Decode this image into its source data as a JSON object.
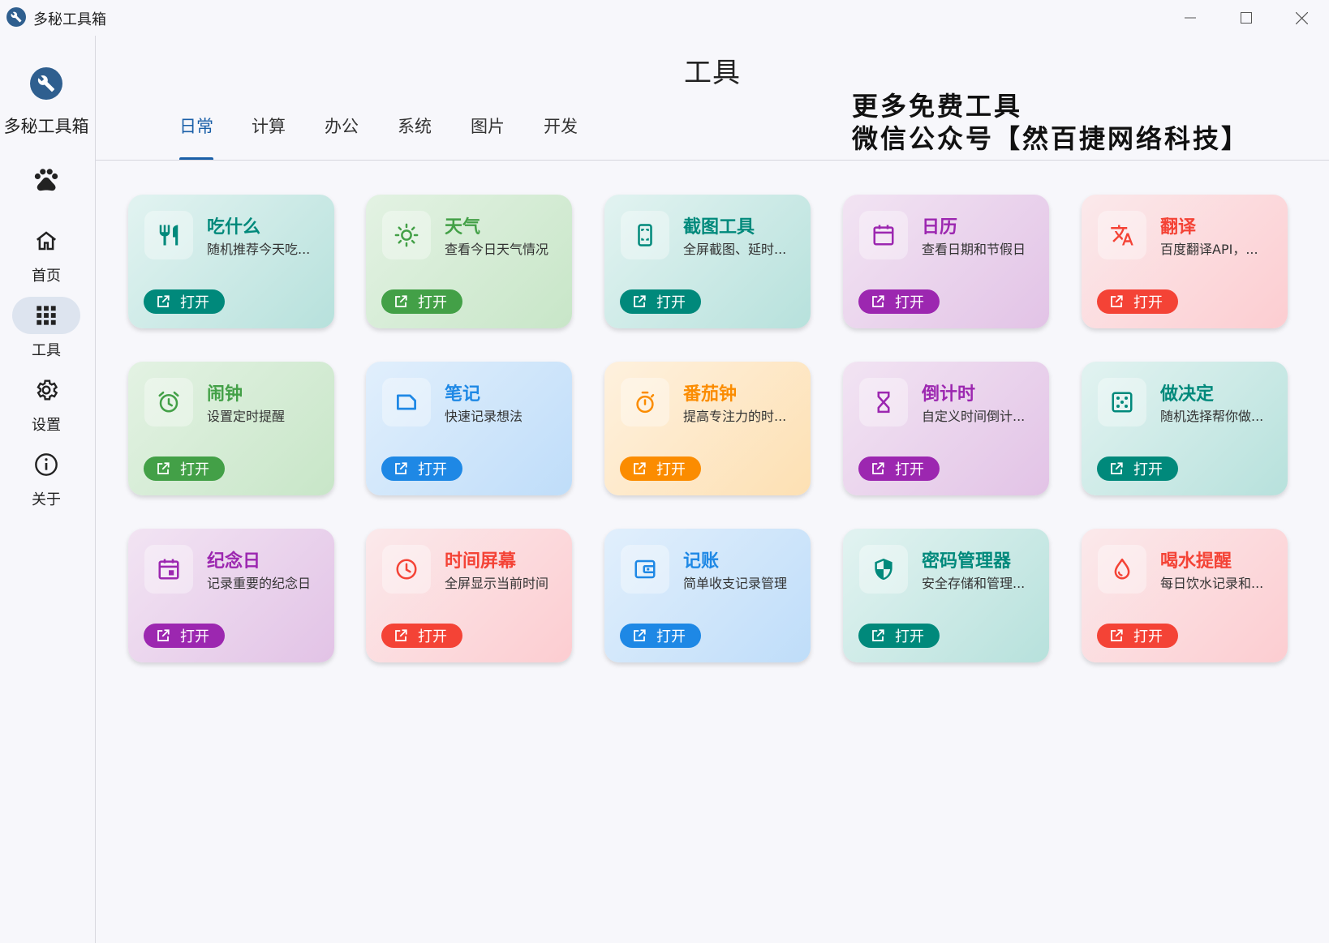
{
  "window": {
    "title": "多秘工具箱",
    "controls": [
      "minimize-icon",
      "maximize-icon",
      "close-icon"
    ]
  },
  "sidebar": {
    "brand": "多秘工具箱",
    "items": [
      {
        "label": "首页",
        "icon": "home-icon",
        "active": false
      },
      {
        "label": "工具",
        "icon": "apps-grid-icon",
        "active": true
      },
      {
        "label": "设置",
        "icon": "gear-icon",
        "active": false
      },
      {
        "label": "关于",
        "icon": "info-icon",
        "active": false
      }
    ]
  },
  "header": {
    "title": "工具",
    "promo_line1": "更多免费工具",
    "promo_line2": "微信公众号【然百捷网络科技】"
  },
  "tabs": [
    {
      "label": "日常",
      "active": true
    },
    {
      "label": "计算",
      "active": false
    },
    {
      "label": "办公",
      "active": false
    },
    {
      "label": "系统",
      "active": false
    },
    {
      "label": "图片",
      "active": false
    },
    {
      "label": "开发",
      "active": false
    }
  ],
  "colors": {
    "teal": "#00897b",
    "green": "#43a047",
    "purple": "#9c27b0",
    "red": "#f44336",
    "blue": "#1e88e5",
    "orange": "#fb8c00",
    "accent": "#1a5fa8"
  },
  "cards": [
    {
      "title": "吃什么",
      "desc": "随机推荐今天吃...",
      "open": "打开",
      "color": "teal",
      "icon": "restaurant-icon"
    },
    {
      "title": "天气",
      "desc": "查看今日天气情况",
      "open": "打开",
      "color": "green",
      "icon": "sun-icon"
    },
    {
      "title": "截图工具",
      "desc": "全屏截图、延时...",
      "open": "打开",
      "color": "teal",
      "icon": "phone-screenshot-icon"
    },
    {
      "title": "日历",
      "desc": "查看日期和节假日",
      "open": "打开",
      "color": "purple",
      "icon": "calendar-icon"
    },
    {
      "title": "翻译",
      "desc": "百度翻译API，...",
      "open": "打开",
      "color": "red",
      "icon": "translate-icon"
    },
    {
      "title": "闹钟",
      "desc": "设置定时提醒",
      "open": "打开",
      "color": "green",
      "icon": "alarm-clock-icon"
    },
    {
      "title": "笔记",
      "desc": "快速记录想法",
      "open": "打开",
      "color": "blue",
      "icon": "note-icon"
    },
    {
      "title": "番茄钟",
      "desc": "提高专注力的时...",
      "open": "打开",
      "color": "orange",
      "icon": "timer-icon"
    },
    {
      "title": "倒计时",
      "desc": "自定义时间倒计...",
      "open": "打开",
      "color": "purple",
      "icon": "hourglass-icon"
    },
    {
      "title": "做决定",
      "desc": "随机选择帮你做...",
      "open": "打开",
      "color": "teal",
      "icon": "dice-icon"
    },
    {
      "title": "纪念日",
      "desc": "记录重要的纪念日",
      "open": "打开",
      "color": "purple",
      "icon": "event-calendar-icon"
    },
    {
      "title": "时间屏幕",
      "desc": "全屏显示当前时间",
      "open": "打开",
      "color": "red",
      "icon": "clock-icon"
    },
    {
      "title": "记账",
      "desc": "简单收支记录管理",
      "open": "打开",
      "color": "blue",
      "icon": "wallet-icon"
    },
    {
      "title": "密码管理器",
      "desc": "安全存储和管理...",
      "open": "打开",
      "color": "teal",
      "icon": "shield-icon"
    },
    {
      "title": "喝水提醒",
      "desc": "每日饮水记录和...",
      "open": "打开",
      "color": "red",
      "icon": "water-drop-icon"
    }
  ]
}
